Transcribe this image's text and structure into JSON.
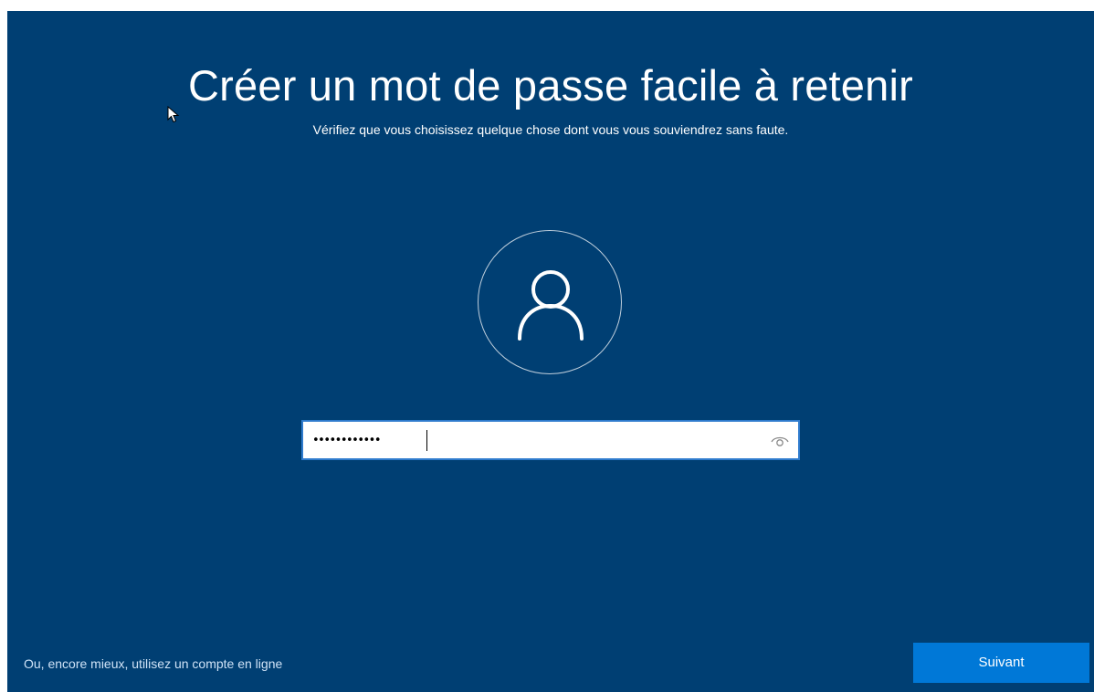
{
  "page": {
    "title": "Créer un mot de passe facile à retenir",
    "subtitle": "Vérifiez que vous choisissez quelque chose dont vous vous souviendrez sans faute."
  },
  "avatar": {
    "icon": "user-icon"
  },
  "password_field": {
    "masked_value": "••••••••••••",
    "reveal_icon": "eye-icon"
  },
  "footer": {
    "online_account_link": "Ou, encore mieux, utilisez un compte en ligne",
    "next_button": "Suivant"
  },
  "colors": {
    "background": "#003f73",
    "accent": "#0078d7",
    "field_border": "#2f7bcd"
  }
}
